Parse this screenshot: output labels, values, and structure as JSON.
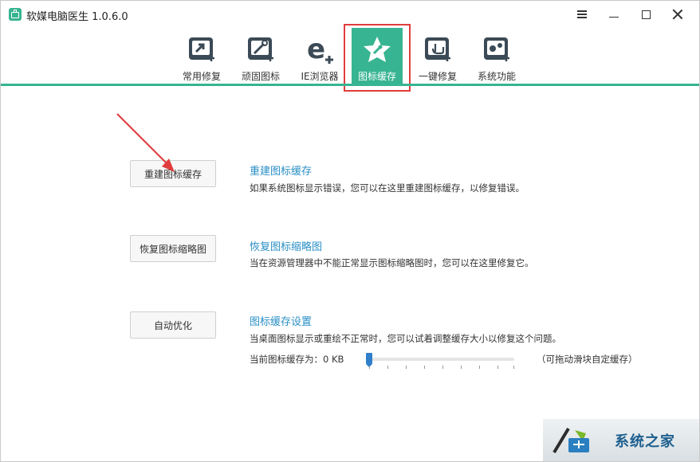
{
  "window": {
    "title": "软媒电脑医生 1.0.6.0",
    "accent_color": "#37b491",
    "highlight_color": "#e03c3c",
    "link_color": "#2a8fc6"
  },
  "toolbar": {
    "items": [
      {
        "label": "常用修复",
        "icon": "common-repair-icon"
      },
      {
        "label": "顽固图标",
        "icon": "stubborn-icon-icon"
      },
      {
        "label": "IE浏览器",
        "icon": "ie-browser-icon"
      },
      {
        "label": "图标缓存",
        "icon": "icon-cache-icon",
        "active": true
      },
      {
        "label": "一键修复",
        "icon": "one-click-repair-icon"
      },
      {
        "label": "系统功能",
        "icon": "system-functions-icon"
      }
    ]
  },
  "sections": [
    {
      "button": "重建图标缓存",
      "title": "重建图标缓存",
      "description": "如果系统图标显示错误，您可以在这里重建图标缓存，以修复错误。"
    },
    {
      "button": "恢复图标缩略图",
      "title": "恢复图标缩略图",
      "description": "当在资源管理器中不能正常显示图标缩略图时，您可以在这里修复它。"
    },
    {
      "button": "自动优化",
      "title": "图标缓存设置",
      "description": "当桌面图标显示或重绘不正常时，您可以试着调整缓存大小以修复这个问题。"
    }
  ],
  "cache_slider": {
    "label": "当前图标缓存为：0 KB",
    "hint": "（可拖动滑块自定缓存）",
    "value_fraction": 0
  },
  "watermark": {
    "text": "系统之家"
  }
}
